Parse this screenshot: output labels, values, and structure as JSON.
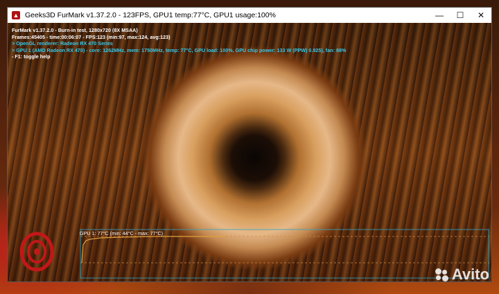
{
  "window": {
    "title": "Geeks3D FurMark v1.37.2.0 - 123FPS, GPU1 temp:77°C, GPU1 usage:100%",
    "buttons": {
      "minimize": "—",
      "maximize": "☐",
      "close": "✕"
    }
  },
  "overlay": {
    "lines": [
      "FurMark v1.37.2.0 - Burn-in test, 1280x720 (8X MSAA)",
      "Frames:45405 - time:00:06:07 - FPS:123 (min:97, max:124, avg:123)",
      "> OpenGL renderer: Radeon RX 470 Series",
      "> GPU 1 (AMD Radeon RX 470) - core: 1262MHz, mem: 1750MHz, temp: 77°C, GPU load: 100%, GPU chip power: 133 W (PPW) 0.925), fan: 88%",
      "- F1: toggle help"
    ]
  },
  "graph": {
    "label": "GPU 1: 77°C (min: 44°C - max: 77°C)",
    "temperature_min": 44,
    "temperature_max": 77,
    "temperature_current": 77,
    "colors": {
      "line": "#e0a040",
      "frame": "#2aa8c8",
      "dashed": "#d08a40"
    }
  },
  "watermark": {
    "text": "Avito"
  },
  "logo": {
    "text": "FurMark"
  }
}
